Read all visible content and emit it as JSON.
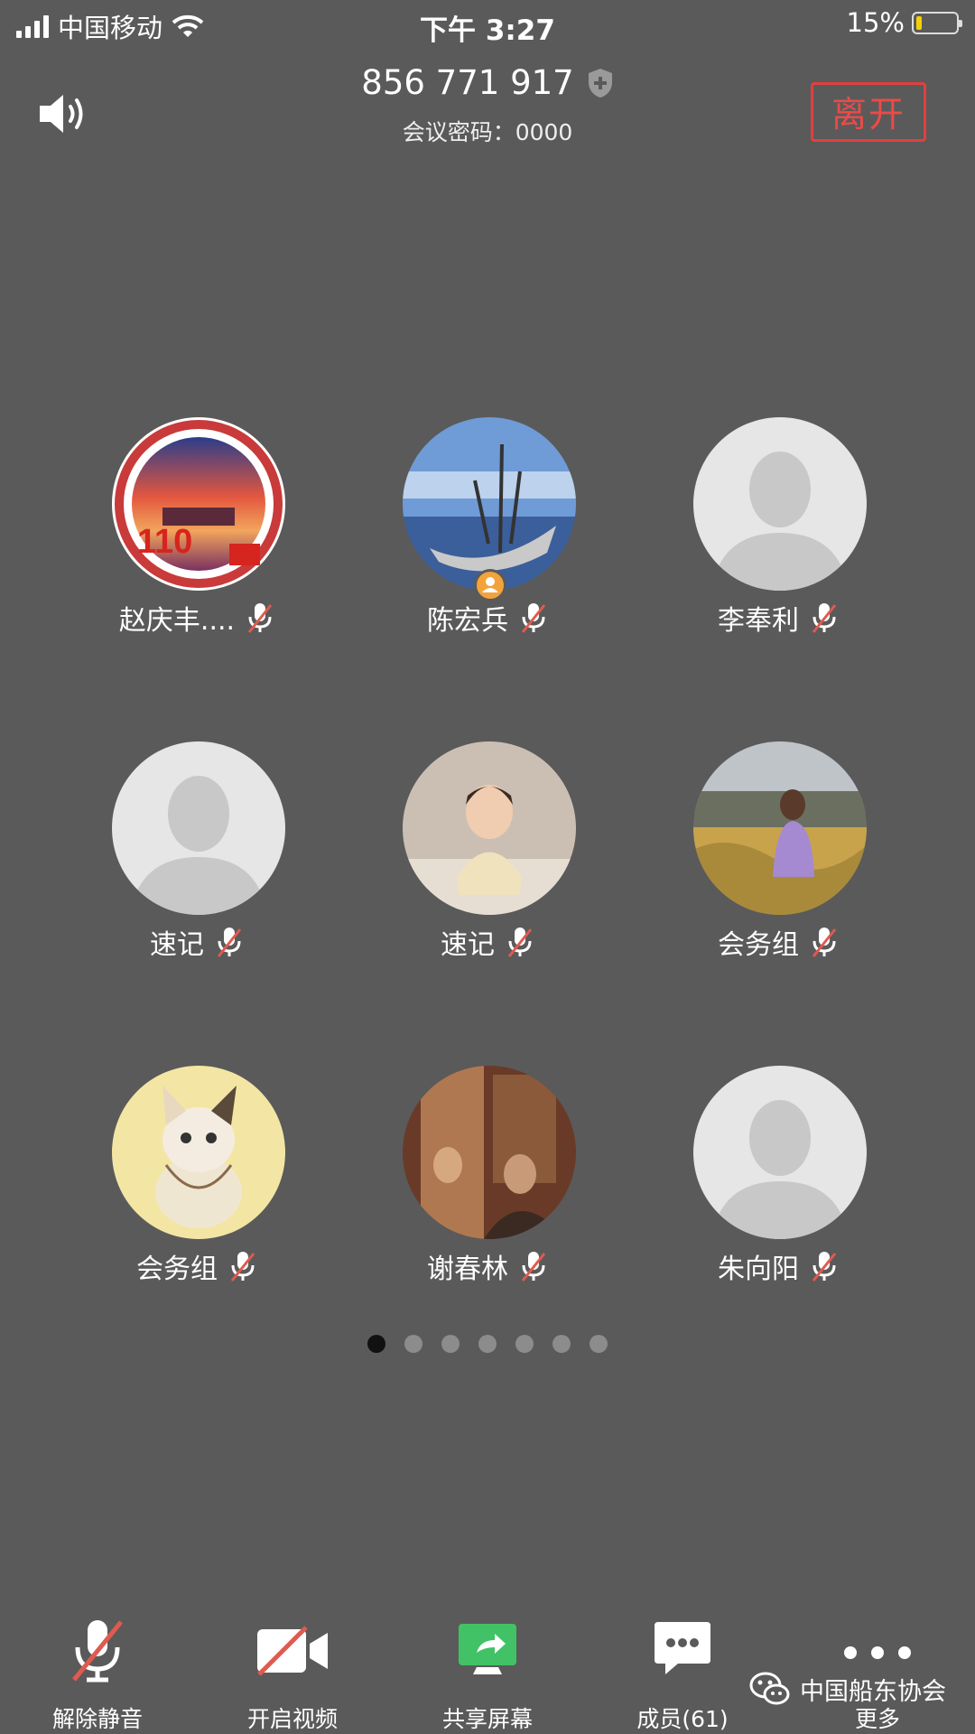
{
  "status_bar": {
    "carrier": "中国移动",
    "time": "下午 3:27",
    "battery": "15%"
  },
  "meeting": {
    "id": "856 771 917",
    "password": "会议密码：0000",
    "leave_label": "离开"
  },
  "participants": [
    {
      "name": "赵庆丰....",
      "host": false
    },
    {
      "name": "陈宏兵",
      "host": true
    },
    {
      "name": "李奉利",
      "host": false
    },
    {
      "name": "速记",
      "host": false
    },
    {
      "name": "速记",
      "host": false
    },
    {
      "name": "会务组",
      "host": false
    },
    {
      "name": "会务组",
      "host": false
    },
    {
      "name": "谢春林",
      "host": false
    },
    {
      "name": "朱向阳",
      "host": false
    }
  ],
  "pagination": {
    "pages": 7,
    "current": 1
  },
  "toolbar": {
    "unmute": "解除静音",
    "video": "开启视频",
    "share": "共享屏幕",
    "members": "成员(61)",
    "more": "更多"
  },
  "watermark": "中国船东协会",
  "colors": {
    "background": "#5a5a5a",
    "leave": "#e0403f",
    "mute_slash": "#e05a50",
    "share_green": "#41c266",
    "host_badge": "#f3a33b"
  }
}
